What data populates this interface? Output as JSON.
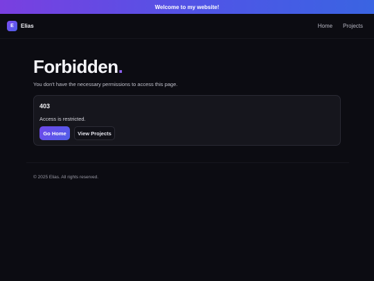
{
  "banner": {
    "text": "Welcome to my website!"
  },
  "header": {
    "logo_letter": "E",
    "brand_name": "Elias",
    "nav": [
      {
        "label": "Home"
      },
      {
        "label": "Projects"
      }
    ]
  },
  "main": {
    "title": "Forbidden",
    "title_dot": ".",
    "subtitle": "You don't have the necessary permissions to access this page."
  },
  "card": {
    "code": "403",
    "message": "Access is restricted.",
    "primary_button": "Go Home",
    "secondary_button": "View Projects"
  },
  "footer": {
    "text": "© 2025 Elias. All rights reserved."
  },
  "colors": {
    "background": "#0c0c12",
    "accent_purple": "#7b4cf0",
    "accent_blue": "#4e5ee8",
    "card_background": "#16161d"
  }
}
